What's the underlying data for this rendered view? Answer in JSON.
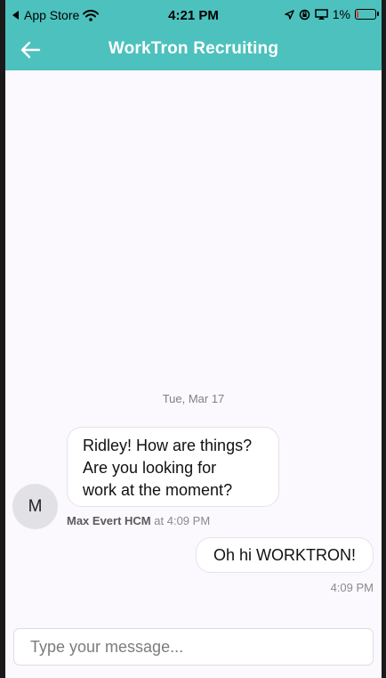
{
  "status_bar": {
    "back_app": "App Store",
    "time": "4:21 PM",
    "battery_percent": "1%",
    "battery_level": 0.01,
    "icons": [
      "back-triangle-icon",
      "wifi-icon",
      "location-arrow-icon",
      "orientation-lock-icon",
      "screen-mirroring-icon",
      "battery-icon"
    ]
  },
  "header": {
    "title": "WorkTron Recruiting",
    "back_icon": "arrow-left-icon",
    "background": "#4dc1bd"
  },
  "chat": {
    "date": "Tue, Mar 17",
    "messages": [
      {
        "direction": "incoming",
        "avatar_initial": "M",
        "text": "Ridley! How are things?\nAre you looking for\nwork at the moment?",
        "sender": "Max Evert HCM",
        "time_prefix": "at",
        "time": "4:09 PM"
      },
      {
        "direction": "outgoing",
        "text": "Oh hi WORKTRON!",
        "time": "4:09 PM"
      }
    ]
  },
  "composer": {
    "placeholder": "Type your message...",
    "value": ""
  }
}
